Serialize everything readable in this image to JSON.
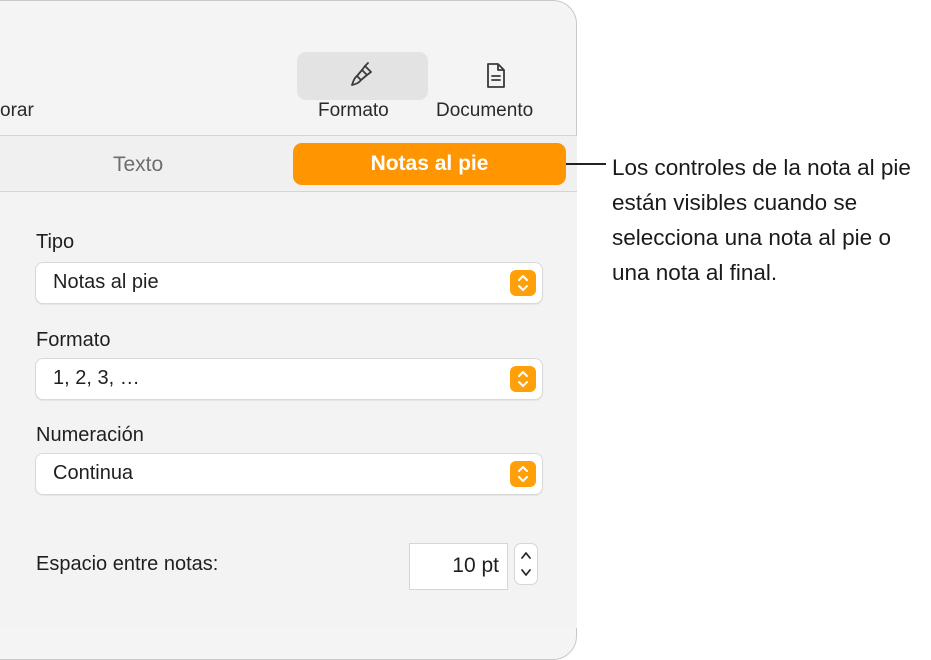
{
  "toolbar": {
    "left_partial_label": "orar",
    "format_label": "Formato",
    "document_label": "Documento"
  },
  "tabs": {
    "text_label": "Texto",
    "footnotes_label": "Notas al pie"
  },
  "panel": {
    "type": {
      "label": "Tipo",
      "value": "Notas al pie"
    },
    "format": {
      "label": "Formato",
      "value": "1, 2, 3, …"
    },
    "numbering": {
      "label": "Numeración",
      "value": "Continua"
    },
    "spacing": {
      "label": "Espacio entre notas:",
      "value": "10 pt"
    }
  },
  "callout": {
    "text": "Los controles de la nota al pie están visibles cuando se selecciona una nota al pie o una nota al final."
  },
  "colors": {
    "accent": "#ff9500",
    "panel_bg": "#f3f3f3"
  },
  "icons": {
    "format": "paintbrush-icon",
    "document": "document-icon",
    "popup_stepper": "chevron-up-down-icon"
  }
}
